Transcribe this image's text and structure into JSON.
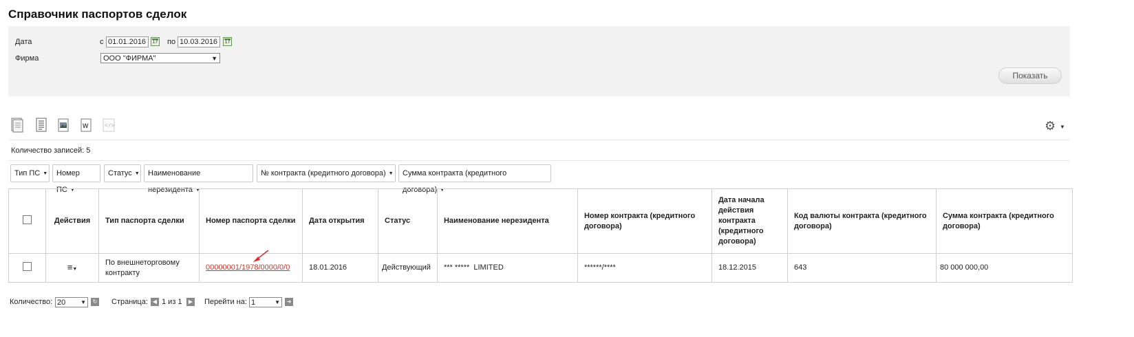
{
  "page": {
    "title": "Справочник паспортов сделок"
  },
  "filters": {
    "date_label": "Дата",
    "from_prefix": "с",
    "from_value": "01.01.2016",
    "to_prefix": "по",
    "to_value": "10.03.2016",
    "firm_label": "Фирма",
    "firm_value": "ООО \"ФИРМА\"",
    "show_button": "Показать",
    "calendar_day": "17"
  },
  "records": {
    "count_label": "Количество записей: 5"
  },
  "column_filters": [
    "Тип ПС",
    "Номер ПС",
    "Статус",
    "Наименование нерезидента",
    "№ контракта (кредитного договора)",
    "Сумма контракта (кредитного договора)"
  ],
  "table": {
    "headers": [
      "Действия",
      "Тип паспорта сделки",
      "Номер паспорта сделки",
      "Дата открытия",
      "Статус",
      "Наименование нерезидента",
      "Номер контракта (кредитного договора)",
      "Дата начала действия контракта (кредитного договора)",
      "Код валюты контракта (кредитного договора)",
      "Сумма контракта (кредитного договора)"
    ],
    "rows": [
      {
        "type": "По внешнеторговому контракту",
        "number": "00000001/1978/0000/0/0",
        "open_date": "18.01.2016",
        "status": "Действующий",
        "nonresident": "*** *****  LIMITED",
        "contract_no": "******/****",
        "contract_start": "18.12.2015",
        "currency_code": "643",
        "amount": "80 000 000,00"
      }
    ]
  },
  "pager": {
    "count_label": "Количество:",
    "count_value": "20",
    "page_label": "Страница:",
    "page_value": "1 из 1",
    "goto_label": "Перейти на:",
    "goto_value": "1"
  },
  "icons": [
    "new-doc-icon",
    "list-doc-icon",
    "image-export-icon",
    "word-export-icon",
    "xml-export-icon",
    "gear-icon",
    "calendar-icon",
    "refresh-icon",
    "prev-page-icon",
    "next-page-icon",
    "go-icon",
    "row-menu-icon",
    "annotation-arrow"
  ]
}
